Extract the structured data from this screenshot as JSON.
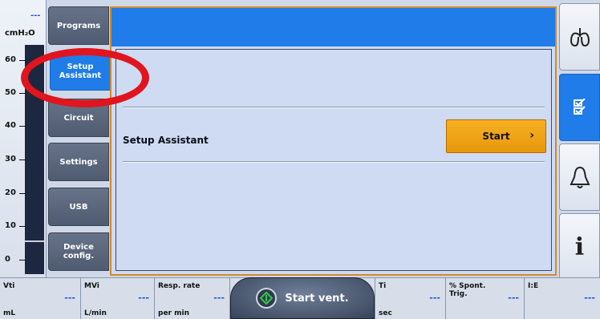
{
  "gauge": {
    "dash": "---",
    "unit": "cmH₂O",
    "ticks": [
      "60",
      "50",
      "40",
      "30",
      "20",
      "10",
      "0"
    ]
  },
  "tabs": [
    {
      "label": "Programs"
    },
    {
      "label": "Setup\nAssistant"
    },
    {
      "label": "Circuit"
    },
    {
      "label": "Settings"
    },
    {
      "label": "USB"
    },
    {
      "label": "Device\nconfig."
    }
  ],
  "main": {
    "row_label": "Setup Assistant",
    "start_label": "Start",
    "start_chevron": "›"
  },
  "rightnav": [
    {
      "icon": "lungs-icon",
      "glyph": "ᗣ"
    },
    {
      "icon": "checklist-icon",
      "glyph": "☑"
    },
    {
      "icon": "bell-icon",
      "glyph": "🔔"
    },
    {
      "icon": "info-icon",
      "glyph": "i"
    }
  ],
  "bottom": {
    "params_left": [
      {
        "name": "Vti",
        "unit": "mL",
        "value": "---"
      },
      {
        "name": "MVi",
        "unit": "L/min",
        "value": "---"
      },
      {
        "name": "Resp. rate",
        "unit": "per min",
        "value": "---"
      }
    ],
    "start_vent_label": "Start vent.",
    "params_right": [
      {
        "name": "Ti",
        "unit": "sec",
        "value": "---"
      },
      {
        "name": "% Spont.\nTrig.",
        "unit": "",
        "value": "---"
      },
      {
        "name": "I:E",
        "unit": "",
        "value": "---"
      }
    ]
  },
  "colors": {
    "active_blue": "#1f7ce8",
    "start_orange": "#f0a318",
    "highlight_red": "#e0151d"
  }
}
